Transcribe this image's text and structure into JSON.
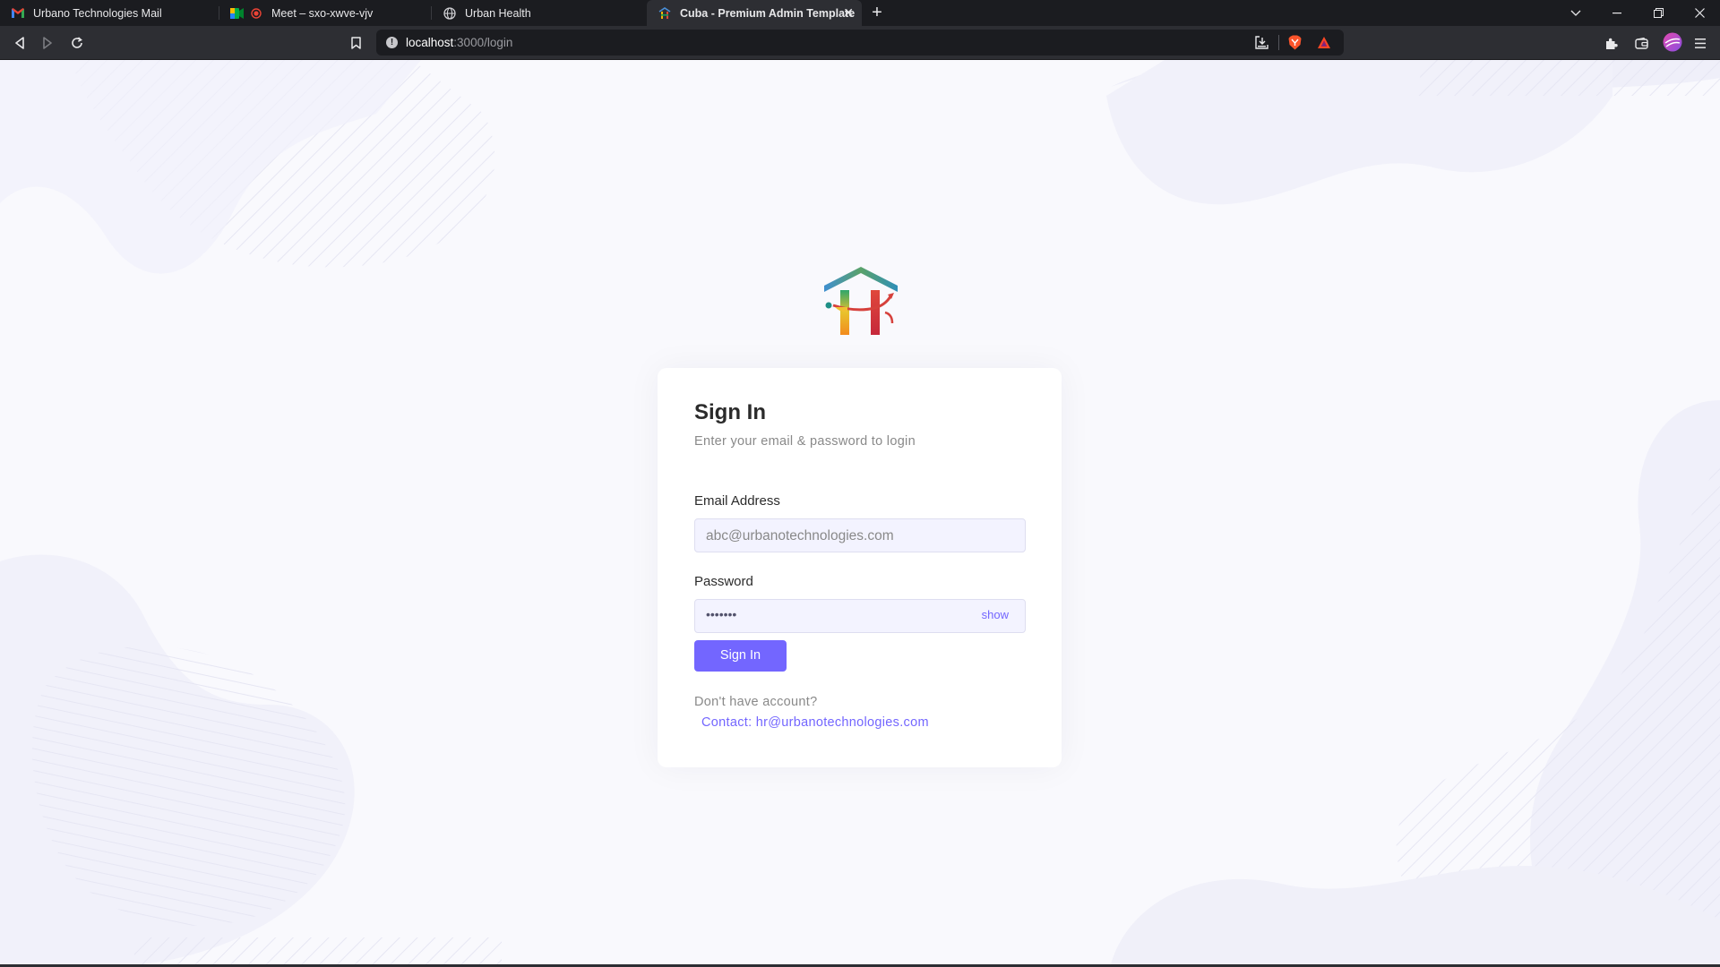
{
  "browser": {
    "tabs": [
      {
        "title": "Urbano Technologies Mail",
        "icon": "gmail-icon"
      },
      {
        "title": "Meet – sxo-xwve-vjv",
        "icon": "meet-icon"
      },
      {
        "title": "Urban Health",
        "icon": "globe-icon"
      },
      {
        "title": "Cuba - Premium Admin Template",
        "icon": "urban-health-logo-icon",
        "active": true
      }
    ],
    "url_host": "localhost",
    "url_path": ":3000/login"
  },
  "login": {
    "title": "Sign In",
    "subtitle": "Enter your email & password to login",
    "email_label": "Email Address",
    "email_placeholder": "abc@urbanotechnologies.com",
    "password_label": "Password",
    "password_value": "•••••••",
    "show_label": "show",
    "submit_label": "Sign In",
    "no_account_text": "Don't have account?",
    "contact_text": "Contact: hr@urbanotechnologies.com"
  },
  "colors": {
    "accent": "#7366ff",
    "tabbar": "#1b1c20",
    "toolbar": "#2d2e33",
    "page_background": "#f9f9fd"
  }
}
